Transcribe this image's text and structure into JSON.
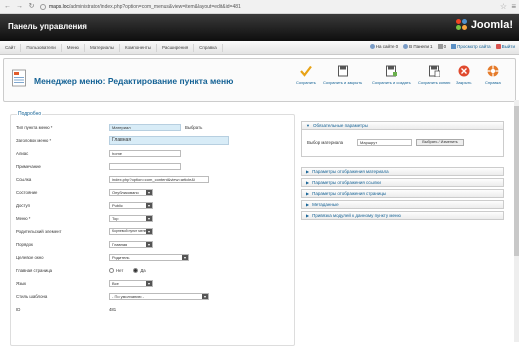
{
  "browser": {
    "url_host": "maps.loc",
    "url_path": "/administrator/index.php?option=com_menus&view=item&layout=edit&id=481"
  },
  "header": {
    "title": "Панель управления",
    "logo_text": "Joomla!"
  },
  "menubar": {
    "items": [
      "Сайт",
      "Пользователи",
      "Меню",
      "Материалы",
      "Компоненты",
      "Расширения",
      "Справка"
    ],
    "status": [
      {
        "label": "На сайте",
        "count": "0"
      },
      {
        "label": "В Панели",
        "count": "1"
      },
      {
        "label": "",
        "count": "0"
      },
      {
        "label": "Просмотр сайта",
        "count": ""
      },
      {
        "label": "Выйти",
        "count": ""
      }
    ]
  },
  "toolbar": {
    "title": "Менеджер меню: Редактирование пункта меню",
    "buttons": [
      {
        "label": "Сохранить",
        "icon": "check-icon",
        "color": "#e8a316"
      },
      {
        "label": "Сохранить и закрыть",
        "icon": "save-icon",
        "color": "#5a5a5a"
      },
      {
        "label": "Сохранить и создать",
        "icon": "save-new-icon",
        "color": "#5a5a5a"
      },
      {
        "label": "Сохранить копию",
        "icon": "save-copy-icon",
        "color": "#5a5a5a"
      },
      {
        "label": "Закрыть",
        "icon": "close-icon",
        "color": "#e04a2e"
      },
      {
        "label": "Справка",
        "icon": "help-icon",
        "color": "#e57b2a"
      }
    ]
  },
  "details": {
    "legend": "Подробно",
    "rows": [
      {
        "label": "Тип пункта меню *",
        "value": "Материал",
        "button": "Выбрать"
      },
      {
        "label": "Заголовок меню *",
        "value": "Главная"
      },
      {
        "label": "Алиас",
        "value": "home"
      },
      {
        "label": "Примечание",
        "value": ""
      },
      {
        "label": "Ссылка",
        "value": "index.php?option=com_content&view=article&i"
      },
      {
        "label": "Состояние",
        "value": "Опубликовано"
      },
      {
        "label": "Доступ",
        "value": "Public"
      },
      {
        "label": "Меню *",
        "value": "Top"
      },
      {
        "label": "Родительский элемент",
        "value": "Корневой пункт меню"
      },
      {
        "label": "Порядок",
        "value": "Главная"
      },
      {
        "label": "Целевое окно",
        "value": "Родитель"
      },
      {
        "label": "Главная страница",
        "options": [
          "Нет",
          "Да"
        ],
        "selected": "Да"
      },
      {
        "label": "Язык",
        "value": "Все"
      },
      {
        "label": "Стиль шаблона",
        "value": "- По умолчанию -"
      },
      {
        "label": "ID",
        "value": "481"
      }
    ]
  },
  "params": {
    "required_title": "Обязательные параметры",
    "article_label": "Выбор материала",
    "article_value": "Маршрут",
    "select_button": "Выбрать / Изменить",
    "sections": [
      "Параметры отображения материала",
      "Параметры отображения ссылки",
      "Параметры отображения страницы",
      "Метаданные",
      "Привязка модулей к данному пункту меню"
    ]
  }
}
